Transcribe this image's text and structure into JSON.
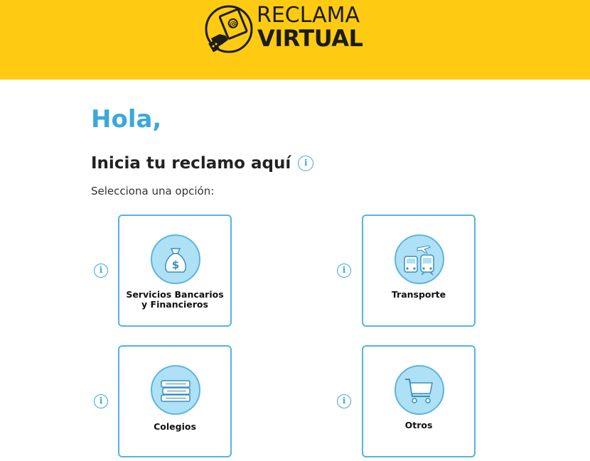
{
  "brand": {
    "line1": "RECLAMA",
    "line2": "VIRTUAL",
    "icon": "hand-holding-email-icon",
    "color": "#fecb12"
  },
  "main": {
    "greeting": "Hola,",
    "heading": "Inicia tu reclamo aquí",
    "subtitle": "Selecciona una opción:",
    "info_glyph": "i"
  },
  "options": [
    {
      "label": "Servicios Bancarios y Financieros",
      "icon": "money-bag-icon"
    },
    {
      "label": "Transporte",
      "icon": "transport-icon"
    },
    {
      "label": "Colegios",
      "icon": "books-icon"
    },
    {
      "label": "Otros",
      "icon": "shopping-cart-icon"
    }
  ],
  "colors": {
    "accent": "#3ca8d8",
    "card_border": "#54b5de",
    "icon_fill": "#aee0f6",
    "header": "#fecb12"
  }
}
